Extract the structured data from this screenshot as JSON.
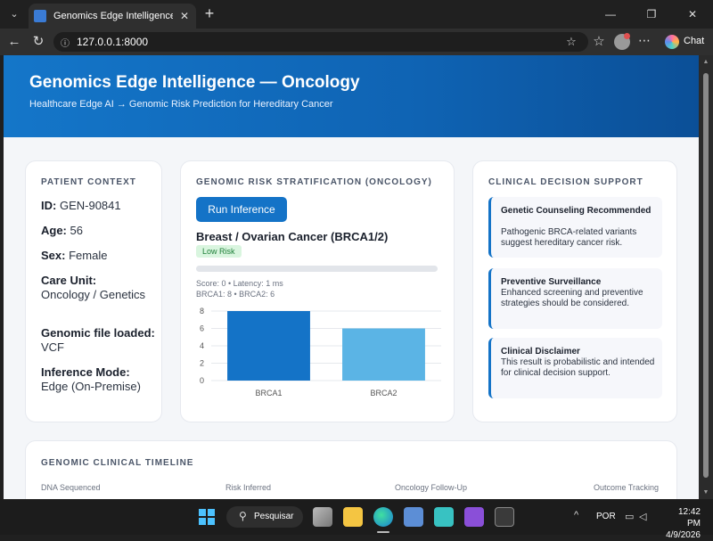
{
  "browser": {
    "tab_title": "Genomics Edge Intelligence — Onc",
    "address": "127.0.0.1:8000",
    "chat_label": "Chat"
  },
  "header": {
    "title": "Genomics Edge Intelligence — Oncology",
    "subtitle": "Healthcare Edge AI → Genomic Risk Prediction for Hereditary Cancer"
  },
  "patient_context": {
    "title": "PATIENT CONTEXT",
    "id_label": "ID:",
    "id_value": "GEN-90841",
    "age_label": "Age:",
    "age_value": "56",
    "sex_label": "Sex:",
    "sex_value": "Female",
    "care_label": "Care Unit:",
    "care_value": "Oncology / Genetics",
    "file_label": "Genomic file loaded:",
    "file_value": "VCF",
    "mode_label": "Inference Mode:",
    "mode_value": "Edge (On-Premise)"
  },
  "risk": {
    "title": "GENOMIC RISK STRATIFICATION (ONCOLOGY)",
    "run_button": "Run Inference",
    "condition": "Breast / Ovarian Cancer (BRCA1/2)",
    "badge": "Low Risk",
    "badge_color": "#20803a",
    "progress_fraction": 0,
    "meta_line1": "Score: 0 • Latency: 1 ms",
    "meta_line2": "BRCA1: 8 • BRCA2: 6"
  },
  "chart_data": {
    "type": "bar",
    "categories": [
      "BRCA1",
      "BRCA2"
    ],
    "values": [
      8,
      6
    ],
    "colors": [
      "#1473c7",
      "#5bb4e5"
    ],
    "ylim": [
      0,
      8
    ],
    "yticks": [
      "0",
      "2",
      "4",
      "6",
      "8"
    ],
    "grid": true
  },
  "decision_support": {
    "title": "CLINICAL DECISION SUPPORT",
    "items": [
      {
        "head": "Genetic Counseling Recommended",
        "body": "Pathogenic BRCA-related variants suggest hereditary cancer risk."
      },
      {
        "head": "Preventive Surveillance",
        "body": "Enhanced screening and preventive strategies should be considered."
      },
      {
        "head": "Clinical Disclaimer",
        "body": "This result is probabilistic and intended for clinical decision support."
      }
    ]
  },
  "timeline": {
    "title": "GENOMIC CLINICAL TIMELINE",
    "steps": [
      "DNA Sequenced",
      "Risk Inferred",
      "Oncology Follow-Up",
      "Outcome Tracking"
    ]
  },
  "taskbar": {
    "search": "Pesquisar",
    "lang": "POR",
    "time": "12:42 PM",
    "date": "4/9/2026"
  }
}
